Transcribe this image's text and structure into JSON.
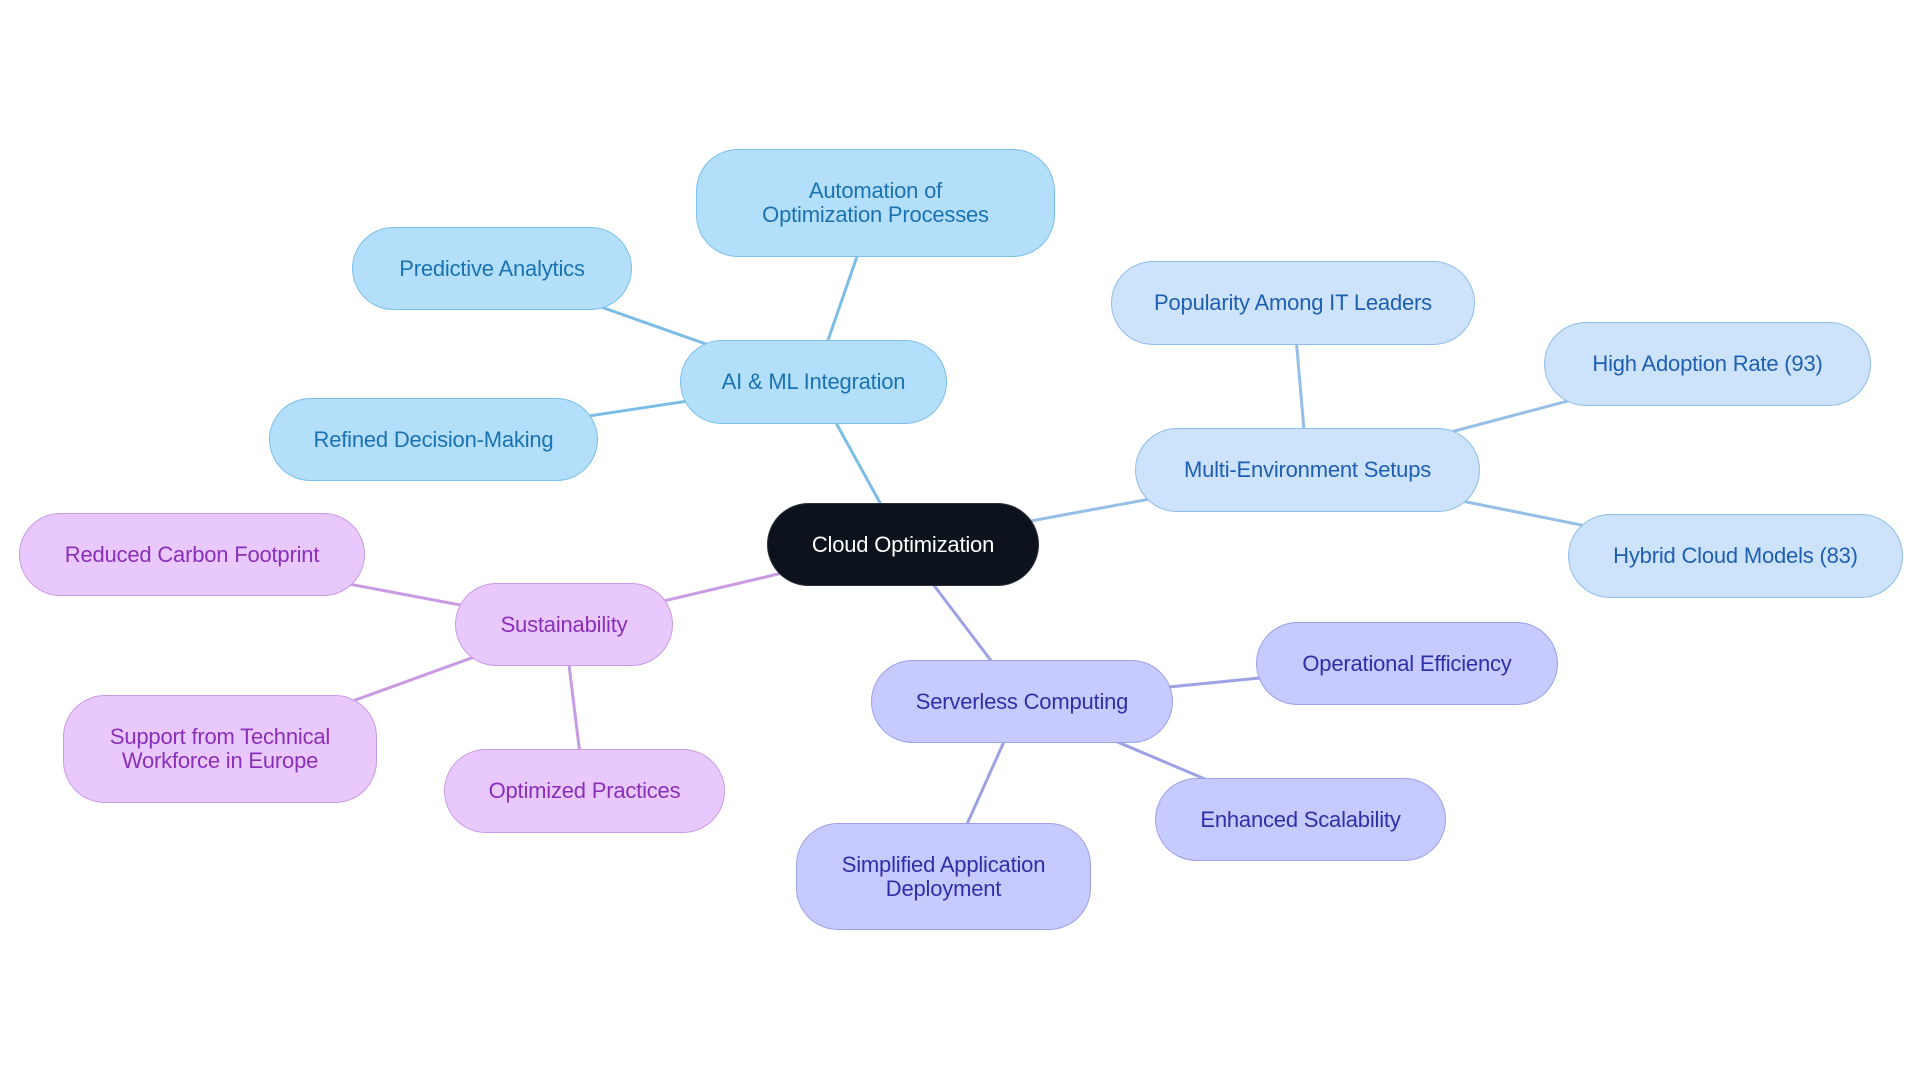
{
  "diagram": {
    "type": "mind-map",
    "root": {
      "id": "root",
      "label": "Cloud Optimization"
    },
    "branches": [
      {
        "id": "ai",
        "label": "AI & ML Integration",
        "color": {
          "fill": "#b3dffb",
          "stroke": "#7cc0ea",
          "text": "#1a73b1",
          "edge": "#7cbde6"
        },
        "children": [
          {
            "id": "ai-1",
            "label": "Automation of Optimization Processes"
          },
          {
            "id": "ai-2",
            "label": "Predictive Analytics"
          },
          {
            "id": "ai-3",
            "label": "Refined Decision-Making"
          }
        ]
      },
      {
        "id": "multi",
        "label": "Multi-Environment Setups",
        "color": {
          "fill": "#cce3fb",
          "stroke": "#90bdea",
          "text": "#1f5fb3",
          "edge": "#96bfe8"
        },
        "children": [
          {
            "id": "multi-1",
            "label": "Popularity Among IT Leaders"
          },
          {
            "id": "multi-2",
            "label": "High Adoption Rate (93)"
          },
          {
            "id": "multi-3",
            "label": "Hybrid Cloud Models (83)"
          }
        ]
      },
      {
        "id": "sust",
        "label": "Sustainability",
        "color": {
          "fill": "#e9c9fd",
          "stroke": "#c99be6",
          "text": "#8a2fb8",
          "edge": "#c89be3"
        },
        "children": [
          {
            "id": "sust-1",
            "label": "Reduced Carbon Footprint"
          },
          {
            "id": "sust-2",
            "label": "Support from Technical Workforce in Europe"
          },
          {
            "id": "sust-3",
            "label": "Optimized Practices"
          }
        ]
      },
      {
        "id": "srv",
        "label": "Serverless Computing",
        "color": {
          "fill": "#c7cafe",
          "stroke": "#9da2e6",
          "text": "#2f2fa8",
          "edge": "#9ea2e3"
        },
        "children": [
          {
            "id": "srv-1",
            "label": "Operational Efficiency"
          },
          {
            "id": "srv-2",
            "label": "Enhanced Scalability"
          },
          {
            "id": "srv-3",
            "label": "Simplified Application Deployment"
          }
        ]
      }
    ],
    "root_color": {
      "fill": "#0d131c",
      "text": "#ffffff"
    }
  }
}
